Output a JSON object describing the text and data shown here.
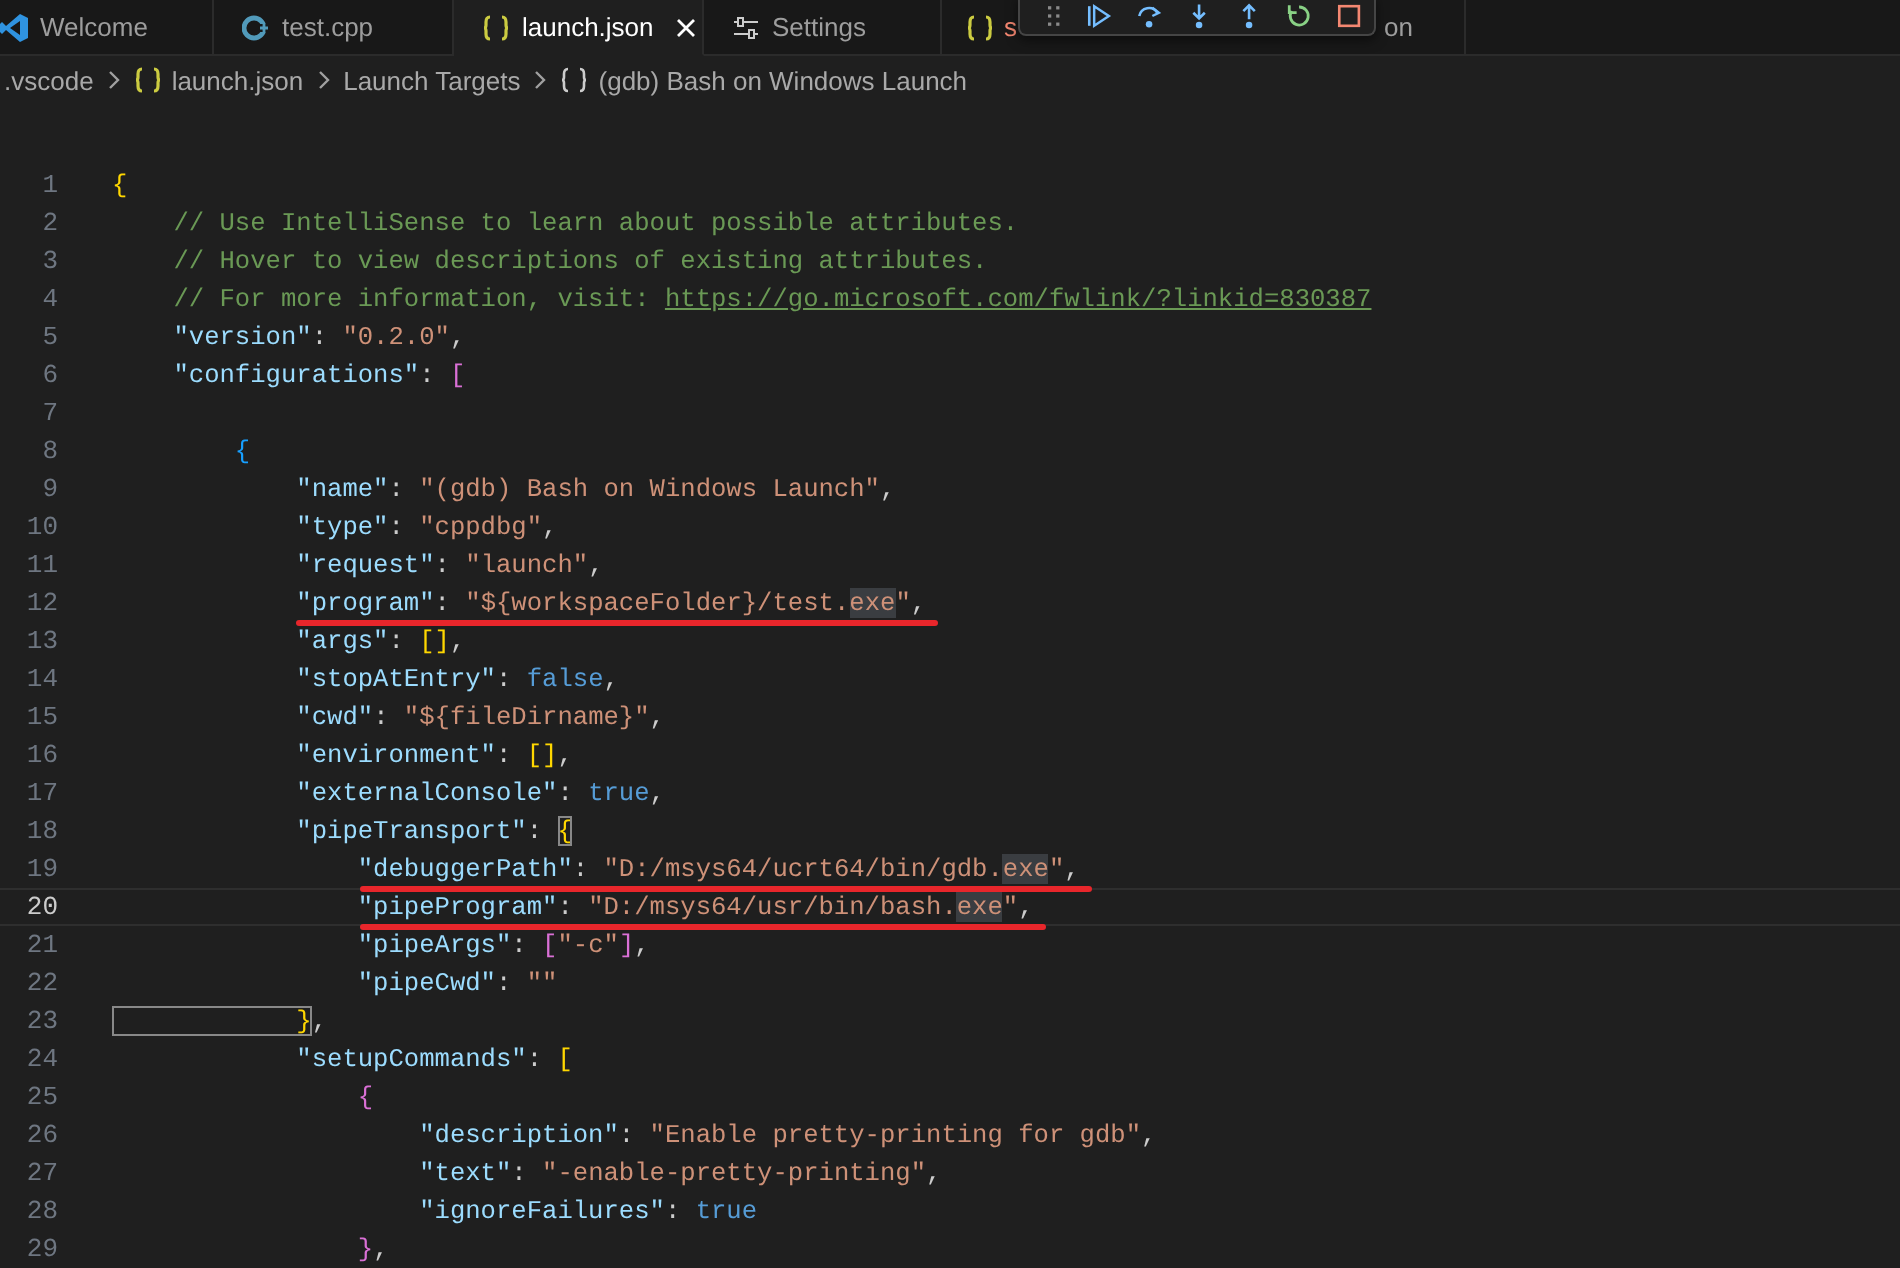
{
  "tabs": [
    {
      "kind": "welcome",
      "label": "Welcome",
      "selected": false
    },
    {
      "kind": "cpp",
      "label": "test.cpp",
      "selected": false
    },
    {
      "kind": "json",
      "label": "launch.json",
      "selected": true
    },
    {
      "kind": "settings",
      "label": "Settings",
      "selected": false
    },
    {
      "kind": "json",
      "label": "s",
      "selected": false
    },
    {
      "kind": "plain",
      "label": "on",
      "selected": false
    }
  ],
  "debug_toolbar": {
    "buttons": [
      {
        "kind": "grip"
      },
      {
        "kind": "continue"
      },
      {
        "kind": "step-over"
      },
      {
        "kind": "step-into"
      },
      {
        "kind": "step-out"
      },
      {
        "kind": "restart"
      },
      {
        "kind": "stop"
      }
    ]
  },
  "breadcrumbs": [
    {
      "kind": "folder",
      "label": ".vscode"
    },
    {
      "kind": "json",
      "label": "launch.json"
    },
    {
      "kind": "folder",
      "label": "Launch Targets"
    },
    {
      "kind": "object",
      "label": "(gdb) Bash on Windows Launch"
    }
  ],
  "lines": [
    {
      "number": "1",
      "current": false,
      "underlined": false,
      "tokens": [
        {
          "kind": "bracket",
          "text": "{",
          "color": "#ffd700",
          "boxed": false
        }
      ]
    },
    {
      "number": "2",
      "current": false,
      "underlined": false,
      "tokens": [
        {
          "kind": "comment",
          "text": "    // Use IntelliSense to learn about possible attributes."
        }
      ]
    },
    {
      "number": "3",
      "current": false,
      "underlined": false,
      "tokens": [
        {
          "kind": "comment",
          "text": "    // Hover to view descriptions of existing attributes."
        }
      ]
    },
    {
      "number": "4",
      "current": false,
      "underlined": false,
      "tokens": [
        {
          "kind": "comment",
          "text": "    // For more information, visit: "
        },
        {
          "kind": "link",
          "text": "https://go.microsoft.com/fwlink/?linkid=830387"
        }
      ]
    },
    {
      "number": "5",
      "current": false,
      "underlined": false,
      "tokens": [
        {
          "kind": "key",
          "text": "    \"version\""
        },
        {
          "kind": "punct",
          "text": ": "
        },
        {
          "kind": "str",
          "text": "\"0.2.0\""
        },
        {
          "kind": "punct",
          "text": ","
        }
      ]
    },
    {
      "number": "6",
      "current": false,
      "underlined": false,
      "tokens": [
        {
          "kind": "key",
          "text": "    \"configurations\""
        },
        {
          "kind": "punct",
          "text": ": "
        },
        {
          "kind": "bracket",
          "text": "[",
          "color": "#da70d6",
          "boxed": false
        }
      ]
    },
    {
      "number": "7",
      "current": false,
      "underlined": false
    },
    {
      "number": "8",
      "current": false,
      "underlined": false,
      "tokens": [
        {
          "kind": "bracket",
          "text": "        {",
          "color": "#179fff",
          "boxed": false
        }
      ]
    },
    {
      "number": "9",
      "current": false,
      "underlined": false,
      "tokens": [
        {
          "kind": "key",
          "text": "            \"name\""
        },
        {
          "kind": "punct",
          "text": ": "
        },
        {
          "kind": "str",
          "text": "\"(gdb) Bash on Windows Launch\""
        },
        {
          "kind": "punct",
          "text": ","
        }
      ]
    },
    {
      "number": "10",
      "current": false,
      "underlined": false,
      "tokens": [
        {
          "kind": "key",
          "text": "            \"type\""
        },
        {
          "kind": "punct",
          "text": ": "
        },
        {
          "kind": "str",
          "text": "\"cppdbg\""
        },
        {
          "kind": "punct",
          "text": ","
        }
      ]
    },
    {
      "number": "11",
      "current": false,
      "underlined": false,
      "tokens": [
        {
          "kind": "key",
          "text": "            \"request\""
        },
        {
          "kind": "punct",
          "text": ": "
        },
        {
          "kind": "str",
          "text": "\"launch\""
        },
        {
          "kind": "punct",
          "text": ","
        }
      ]
    },
    {
      "number": "12",
      "current": false,
      "underlined": true,
      "tokens": [
        {
          "kind": "key",
          "text": "            \"program\""
        },
        {
          "kind": "punct",
          "text": ": "
        },
        {
          "kind": "str",
          "text": "\"${workspaceFolder}/test."
        },
        {
          "kind": "match",
          "text": "exe"
        },
        {
          "kind": "str",
          "text": "\""
        },
        {
          "kind": "punct",
          "text": ","
        }
      ]
    },
    {
      "number": "13",
      "current": false,
      "underlined": false,
      "tokens": [
        {
          "kind": "key",
          "text": "            \"args\""
        },
        {
          "kind": "punct",
          "text": ": "
        },
        {
          "kind": "bracket",
          "text": "[]",
          "color": "#ffd700",
          "boxed": false
        },
        {
          "kind": "punct",
          "text": ","
        }
      ]
    },
    {
      "number": "14",
      "current": false,
      "underlined": false,
      "tokens": [
        {
          "kind": "key",
          "text": "            \"stopAtEntry\""
        },
        {
          "kind": "punct",
          "text": ": "
        },
        {
          "kind": "kw",
          "text": "false"
        },
        {
          "kind": "punct",
          "text": ","
        }
      ]
    },
    {
      "number": "15",
      "current": false,
      "underlined": false,
      "tokens": [
        {
          "kind": "key",
          "text": "            \"cwd\""
        },
        {
          "kind": "punct",
          "text": ": "
        },
        {
          "kind": "str",
          "text": "\"${fileDirname}\""
        },
        {
          "kind": "punct",
          "text": ","
        }
      ]
    },
    {
      "number": "16",
      "current": false,
      "underlined": false,
      "tokens": [
        {
          "kind": "key",
          "text": "            \"environment\""
        },
        {
          "kind": "punct",
          "text": ": "
        },
        {
          "kind": "bracket",
          "text": "[]",
          "color": "#ffd700",
          "boxed": false
        },
        {
          "kind": "punct",
          "text": ","
        }
      ]
    },
    {
      "number": "17",
      "current": false,
      "underlined": false,
      "tokens": [
        {
          "kind": "key",
          "text": "            \"externalConsole\""
        },
        {
          "kind": "punct",
          "text": ": "
        },
        {
          "kind": "kw",
          "text": "true"
        },
        {
          "kind": "punct",
          "text": ","
        }
      ]
    },
    {
      "number": "18",
      "current": false,
      "underlined": false,
      "tokens": [
        {
          "kind": "key",
          "text": "            \"pipeTransport\""
        },
        {
          "kind": "punct",
          "text": ": "
        },
        {
          "kind": "bracket",
          "text": "{",
          "color": "#ffd700",
          "boxed": true
        }
      ]
    },
    {
      "number": "19",
      "current": false,
      "underlined": true,
      "tokens": [
        {
          "kind": "key",
          "text": "                \"debuggerPath\""
        },
        {
          "kind": "punct",
          "text": ": "
        },
        {
          "kind": "str",
          "text": "\"D:/msys64/ucrt64/bin/gdb."
        },
        {
          "kind": "match",
          "text": "exe"
        },
        {
          "kind": "str",
          "text": "\""
        },
        {
          "kind": "punct",
          "text": ","
        }
      ]
    },
    {
      "number": "20",
      "current": true,
      "underlined": true,
      "tokens": [
        {
          "kind": "key",
          "text": "                \"pipeProgram\""
        },
        {
          "kind": "punct",
          "text": ": "
        },
        {
          "kind": "str",
          "text": "\"D:/msys64/usr/bin/bash."
        },
        {
          "kind": "match",
          "text": "exe"
        },
        {
          "kind": "str",
          "text": "\""
        },
        {
          "kind": "punct",
          "text": ","
        }
      ]
    },
    {
      "number": "21",
      "current": false,
      "underlined": false,
      "tokens": [
        {
          "kind": "key",
          "text": "                \"pipeArgs\""
        },
        {
          "kind": "punct",
          "text": ": "
        },
        {
          "kind": "bracket",
          "text": "[",
          "color": "#da70d6",
          "boxed": false
        },
        {
          "kind": "str",
          "text": "\"-c\""
        },
        {
          "kind": "bracket",
          "text": "]",
          "color": "#da70d6",
          "boxed": false
        },
        {
          "kind": "punct",
          "text": ","
        }
      ]
    },
    {
      "number": "22",
      "current": false,
      "underlined": false,
      "tokens": [
        {
          "kind": "key",
          "text": "                \"pipeCwd\""
        },
        {
          "kind": "punct",
          "text": ": "
        },
        {
          "kind": "str",
          "text": "\"\""
        }
      ]
    },
    {
      "number": "23",
      "current": false,
      "underlined": false,
      "tokens": [
        {
          "kind": "bracket",
          "text": "            }",
          "color": "#ffd700",
          "boxed": true
        },
        {
          "kind": "punct",
          "text": ","
        }
      ]
    },
    {
      "number": "24",
      "current": false,
      "underlined": false,
      "tokens": [
        {
          "kind": "key",
          "text": "            \"setupCommands\""
        },
        {
          "kind": "punct",
          "text": ": "
        },
        {
          "kind": "bracket",
          "text": "[",
          "color": "#ffd700",
          "boxed": false
        }
      ]
    },
    {
      "number": "25",
      "current": false,
      "underlined": false,
      "tokens": [
        {
          "kind": "bracket",
          "text": "                {",
          "color": "#da70d6",
          "boxed": false
        }
      ]
    },
    {
      "number": "26",
      "current": false,
      "underlined": false,
      "tokens": [
        {
          "kind": "key",
          "text": "                    \"description\""
        },
        {
          "kind": "punct",
          "text": ": "
        },
        {
          "kind": "str",
          "text": "\"Enable pretty-printing for gdb\""
        },
        {
          "kind": "punct",
          "text": ","
        }
      ]
    },
    {
      "number": "27",
      "current": false,
      "underlined": false,
      "tokens": [
        {
          "kind": "key",
          "text": "                    \"text\""
        },
        {
          "kind": "punct",
          "text": ": "
        },
        {
          "kind": "str",
          "text": "\"-enable-pretty-printing\""
        },
        {
          "kind": "punct",
          "text": ","
        }
      ]
    },
    {
      "number": "28",
      "current": false,
      "underlined": false,
      "tokens": [
        {
          "kind": "key",
          "text": "                    \"ignoreFailures\""
        },
        {
          "kind": "punct",
          "text": ": "
        },
        {
          "kind": "kw",
          "text": "true"
        }
      ]
    },
    {
      "number": "29",
      "current": false,
      "underlined": false,
      "tokens": [
        {
          "kind": "bracket",
          "text": "                }",
          "color": "#da70d6",
          "boxed": false
        },
        {
          "kind": "punct",
          "text": ","
        }
      ]
    }
  ]
}
